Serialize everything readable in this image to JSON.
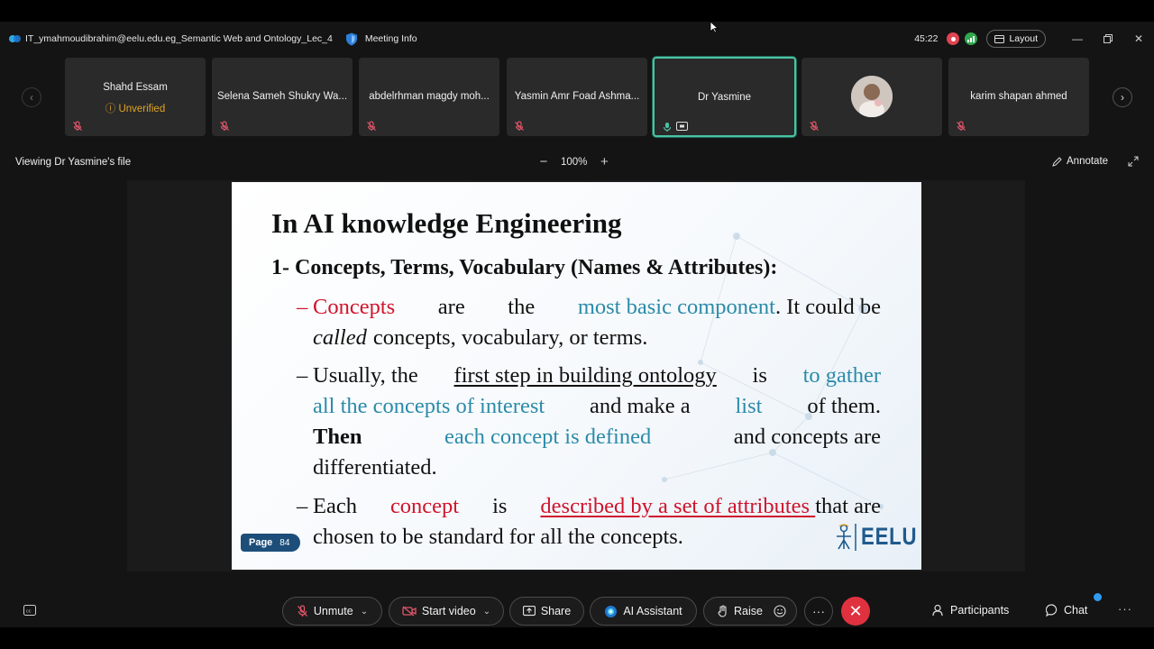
{
  "window": {
    "title": "IT_ymahmoudibrahim@eelu.edu.eg_Semantic Web and Ontology_Lec_4",
    "meeting_info": "Meeting Info",
    "timer": "45:22",
    "layout_label": "Layout"
  },
  "participants": [
    {
      "name": "Shahd Essam",
      "sub": "Unverified",
      "muted": true
    },
    {
      "name": "Selena Sameh Shukry Wa...",
      "muted": true
    },
    {
      "name": "abdelrhman magdy moh...",
      "muted": true
    },
    {
      "name": "Yasmin Amr Foad Ashma...",
      "muted": true
    },
    {
      "name": "Dr Yasmine",
      "active": true,
      "sharing": true
    },
    {
      "name": "",
      "has_avatar": true,
      "muted": true
    },
    {
      "name": "karim shapan ahmed",
      "muted": true
    }
  ],
  "share": {
    "viewing_label": "Viewing Dr Yasmine's file",
    "zoom": "100%",
    "zoom_minus": "−",
    "zoom_plus": "+",
    "annotate_label": "Annotate"
  },
  "slide": {
    "title": "In AI knowledge Engineering",
    "subtitle": "1- Concepts, Terms, Vocabulary (Names & Attributes):",
    "b1": {
      "dash": "–",
      "w1": "Concepts",
      "w2": "are",
      "w3": "the",
      "w4": "most basic component",
      "w5": ". It could be",
      "l2a": "called",
      "l2b": "concepts, vocabulary, or terms."
    },
    "b2": {
      "dash": "–",
      "l1a": "Usually, the",
      "l1b": "first step in building ontology",
      "l1c": "is",
      "l1d": "to gather",
      "l2a": "all the concepts of interest",
      "l2b": "and make a",
      "l2c": "list",
      "l2d": "of them.",
      "l3a": "Then",
      "l3b": "each concept is defined",
      "l3c": "and concepts are",
      "l4": "differentiated."
    },
    "b3": {
      "dash": "–",
      "l1a": "Each",
      "l1b": "concept",
      "l1c": "is",
      "l1d": "described by a set of attributes ",
      "l1e": "that are",
      "l2": "chosen to be standard for all the concepts."
    },
    "page_label": "Page",
    "page_number": "84",
    "logo_text": "EELU"
  },
  "toolbar": {
    "unmute": "Unmute",
    "start_video": "Start video",
    "share": "Share",
    "ai_assistant": "AI Assistant",
    "raise": "Raise",
    "more": "···",
    "participants": "Participants",
    "chat": "Chat"
  },
  "colors": {
    "accent_active": "#4cc2a4",
    "leave_red": "#e0313f",
    "slide_red": "#d0142c",
    "slide_blue": "#2b8ba9",
    "unverified": "#e0a427"
  }
}
